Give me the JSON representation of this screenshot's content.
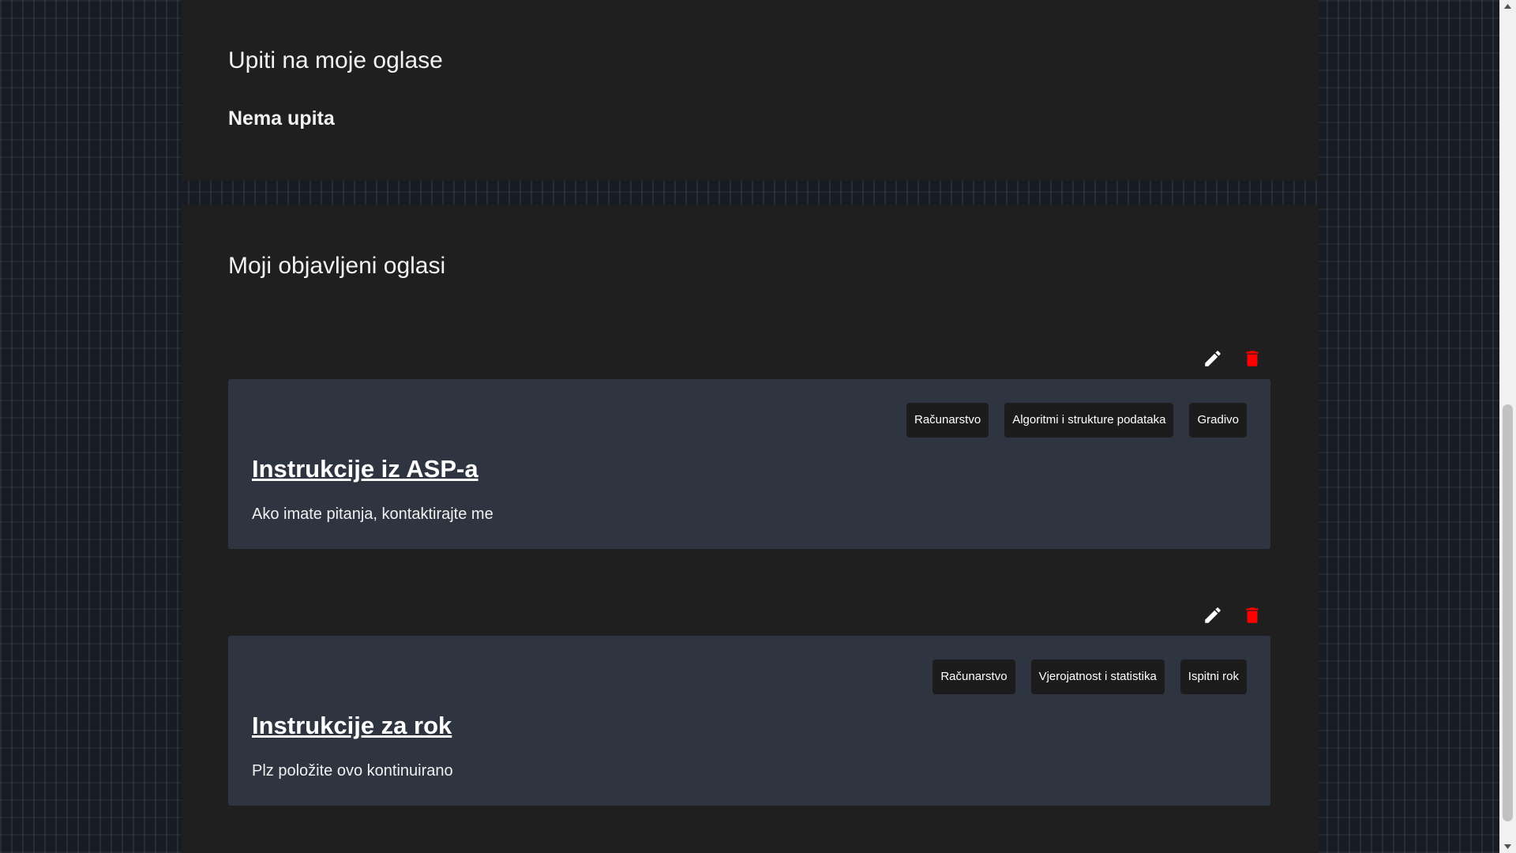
{
  "inquiries": {
    "title": "Upiti na moje oglase",
    "empty_text": "Nema upita"
  },
  "my_ads": {
    "title": "Moji objavljeni oglasi",
    "ads": [
      {
        "title": "Instrukcije iz ASP-a",
        "description": "Ako imate pitanja, kontaktirajte me",
        "tags": [
          "Računarstvo",
          "Algoritmi i strukture podataka",
          "Gradivo"
        ]
      },
      {
        "title": "Instrukcije za rok",
        "description": "Plz položite ovo kontinuirano",
        "tags": [
          "Računarstvo",
          "Vjerojatnost i statistika",
          "Ispitni rok"
        ]
      }
    ]
  },
  "icons": {
    "edit": "pencil-icon",
    "delete": "trash-icon"
  },
  "colors": {
    "delete_icon": "#ff0000",
    "edit_icon": "#ffffff",
    "card_bg": "#2f3540",
    "panel_bg": "#1f1f1f"
  }
}
